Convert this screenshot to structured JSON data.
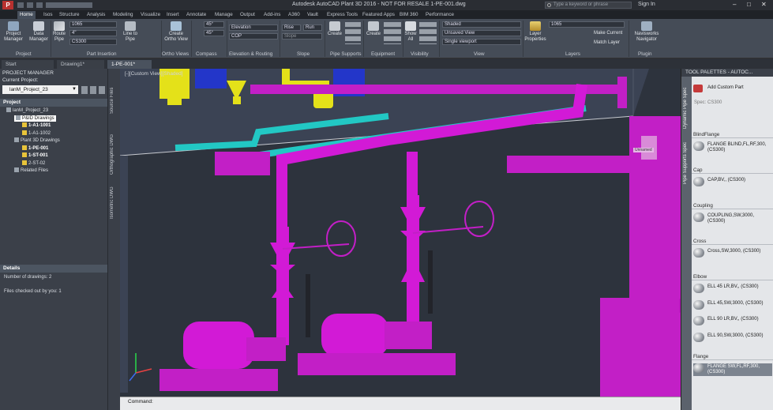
{
  "window": {
    "title": "Autodesk AutoCAD Plant 3D 2016 - NOT FOR RESALE    1-PE-001.dwg",
    "search_placeholder": "Type a keyword or phrase",
    "sign_in": "Sign In"
  },
  "ribbon_tabs": [
    "Home",
    "Isos",
    "Structure",
    "Analysis",
    "Modeling",
    "Visualize",
    "Insert",
    "Annotate",
    "Manage",
    "Output",
    "Add-ins",
    "A360",
    "Vault",
    "Express Tools",
    "Featured Apps",
    "BIM 360",
    "Performance"
  ],
  "ribbon": {
    "groups": [
      "Project",
      "Part Insertion",
      "Ortho Views",
      "Compass",
      "Elevation & Routing",
      "Slope",
      "Pipe Supports",
      "Equipment",
      "Visibility",
      "View",
      "Layers",
      "Plugin"
    ],
    "buttons": {
      "project_manager": "Project Manager",
      "data_manager": "Data Manager",
      "route_pipe": "Route Pipe",
      "line_to_pipe": "Line to Pipe",
      "create_ortho_view": "Create Ortho View",
      "elevation": "Elevation",
      "rise": "Rise",
      "run": "Run",
      "slope": "Slope",
      "create_support": "Create",
      "create_equipment": "Create",
      "show_all": "Show All",
      "layer_properties": "Layer Properties",
      "make_current": "Make Current",
      "match_layer": "Match Layer",
      "navisworks_navigator": "Navisworks Navigator"
    },
    "combos": {
      "size": "1065",
      "nominal": "4\"",
      "spec": "CS300",
      "angle1": "45°",
      "angle2": "45°",
      "cop": "COP",
      "visual_style": "Shaded",
      "named_view": "Unsaved View",
      "viewport": "Single viewport",
      "layer": "1065"
    }
  },
  "doc_tabs": [
    "Start",
    "Drawing1*",
    "1-PE-001*"
  ],
  "project_manager": {
    "header": "PROJECT MANAGER",
    "current_project_label": "Current Project:",
    "current_project": "lanM_Project_23",
    "section_project": "Project",
    "tree": [
      {
        "label": "lanM_Project_23",
        "level": 0,
        "bold": false,
        "selected": false
      },
      {
        "label": "P&ID Drawings",
        "level": 1,
        "bold": false,
        "selected": true
      },
      {
        "label": "1-A1-1001",
        "level": 2,
        "bold": true,
        "selected": false
      },
      {
        "label": "1-A1-1002",
        "level": 2,
        "bold": false,
        "selected": false
      },
      {
        "label": "Plant 3D Drawings",
        "level": 1,
        "bold": false,
        "selected": false
      },
      {
        "label": "1-PE-001",
        "level": 2,
        "bold": true,
        "selected": false
      },
      {
        "label": "1-ST-001",
        "level": 2,
        "bold": true,
        "selected": false
      },
      {
        "label": "2-ST-02",
        "level": 2,
        "bold": false,
        "selected": false
      },
      {
        "label": "Related Files",
        "level": 1,
        "bold": false,
        "selected": false
      }
    ],
    "details_header": "Details",
    "details": [
      "Number of drawings: 2",
      "Files checked out by you: 1"
    ]
  },
  "side_tabs": [
    "Source Files",
    "Orthographic DWG",
    "Isometric DWG"
  ],
  "viewport": {
    "label": "[-][Custom View][Shaded]",
    "viewcube_label": "Unnamed"
  },
  "command": {
    "line1": "Command:"
  },
  "tool_palette": {
    "title": "TOOL PALETTES - AUTOC...",
    "side_tabs": [
      "Dynamic Pipe Spec",
      "Pipe Supports Spec"
    ],
    "add_custom_part": "Add Custom Part",
    "spec": "Spec: CS300",
    "categories": [
      {
        "name": "BlindFlange",
        "items": [
          "FLANGE BLIND,FL,RF,300, (CS300)"
        ]
      },
      {
        "name": "Cap",
        "items": [
          "CAP,BV,, (CS300)"
        ]
      },
      {
        "name": "Coupling",
        "items": [
          "COUPLING,SW,3000, (CS300)"
        ]
      },
      {
        "name": "Cross",
        "items": [
          "Cross,SW,3000, (CS300)"
        ]
      },
      {
        "name": "Elbow",
        "items": [
          "ELL 45 LR,BV,, (CS300)",
          "ELL 45,SW,3000, (CS300)",
          "ELL 90 LR,BV,, (CS300)",
          "ELL 90,SW,3000, (CS300)"
        ]
      },
      {
        "name": "Flange",
        "items": [
          "FLANGE SW,FL,RF,300, (CS300)"
        ]
      }
    ]
  },
  "colors": {
    "pipe_magenta": "#d21ad6",
    "pipe_cyan": "#22c8c4",
    "equipment_yellow": "#e8e019",
    "viewport_bg": "#2d333d"
  }
}
